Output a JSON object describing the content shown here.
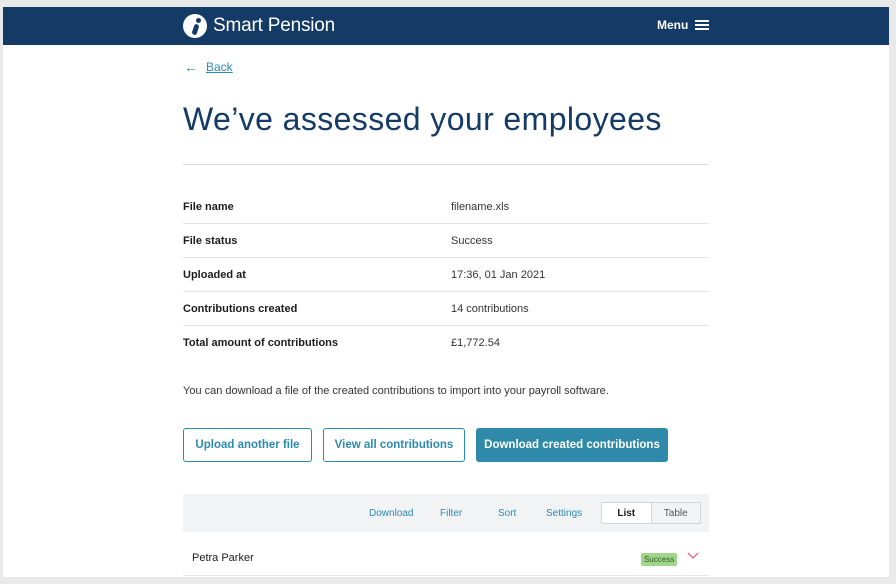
{
  "header": {
    "brand": "Smart Pension",
    "menu_label": "Menu"
  },
  "nav": {
    "back_label": "Back"
  },
  "page": {
    "title": "We’ve assessed your employees"
  },
  "details": [
    {
      "label": "File name",
      "value": "filename.xls"
    },
    {
      "label": "File status",
      "value": "Success"
    },
    {
      "label": "Uploaded at",
      "value": "17:36, 01 Jan 2021"
    },
    {
      "label": "Contributions created",
      "value": "14 contributions"
    },
    {
      "label": "Total amount of contributions",
      "value": "£1,772.54"
    }
  ],
  "intro_text": "You can download a file of the created contributions to import into your payroll software.",
  "actions": {
    "upload_label": "Upload another file",
    "view_label": "View all contributions",
    "download_label": "Download created contributions"
  },
  "toolbar": {
    "download": "Download",
    "filter": "Filter",
    "sort": "Sort",
    "settings": "Settings",
    "view_list": "List",
    "view_table": "Table",
    "selected_view": "List"
  },
  "rows": [
    {
      "name": "Petra Parker",
      "status": "Success"
    }
  ],
  "colors": {
    "navy": "#143a66",
    "accent": "#2b8ab3",
    "primary_button": "#2e8aa8",
    "success_badge": "#9fd68a",
    "chevron": "#e0738a"
  },
  "icons": {
    "back": "arrow-left-icon",
    "menu": "hamburger-icon",
    "row_expand": "chevron-down-icon"
  }
}
